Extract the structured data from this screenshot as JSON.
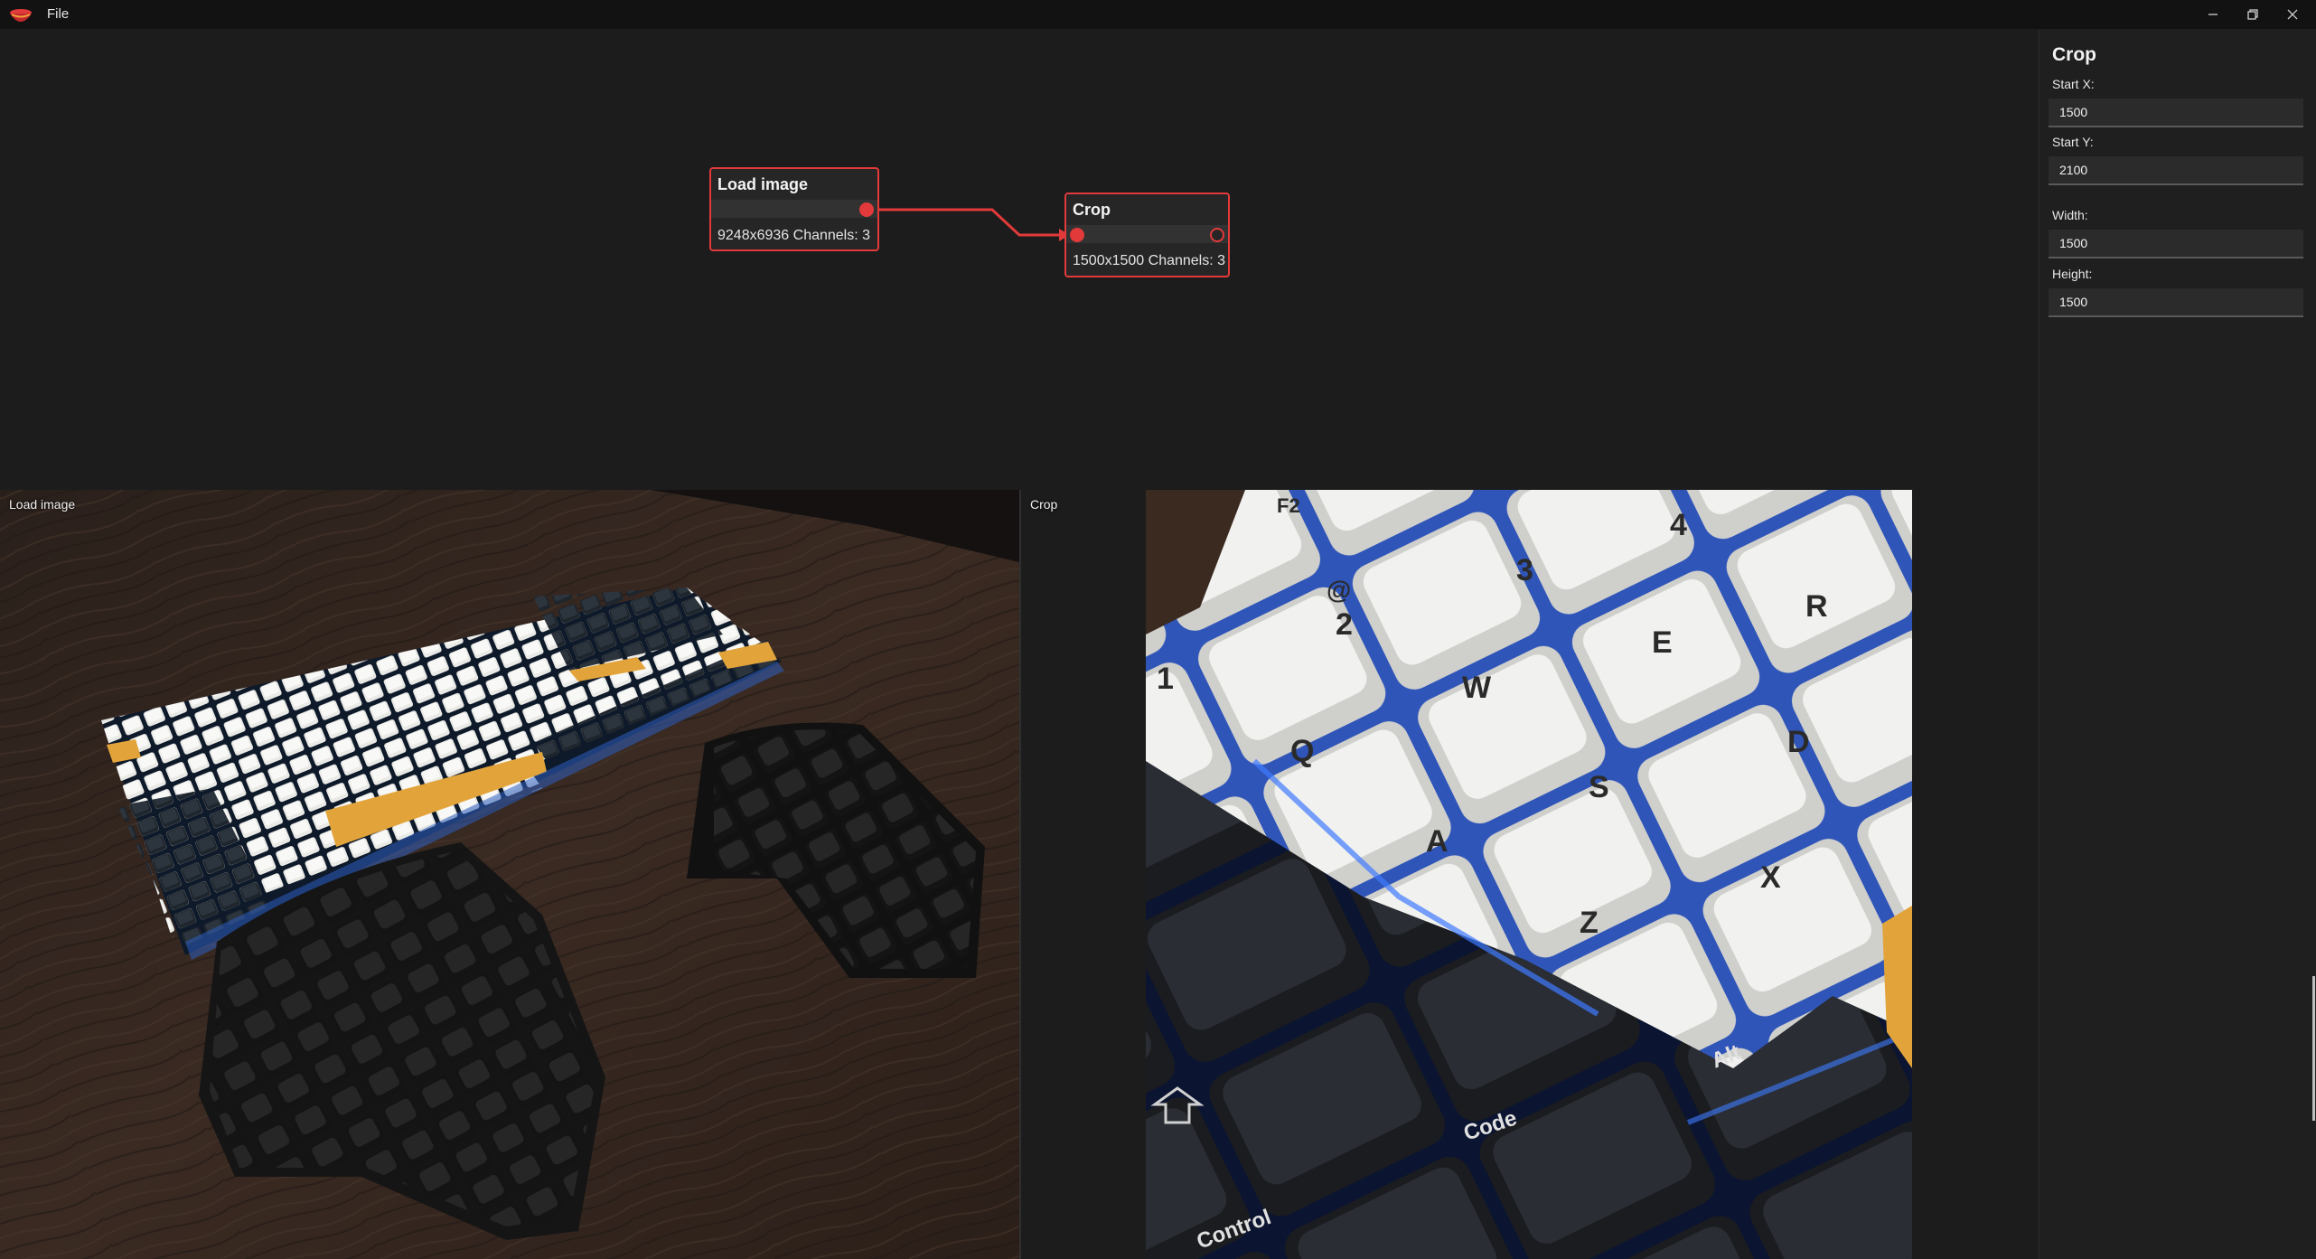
{
  "titlebar": {
    "menu": [
      {
        "label": "File"
      }
    ],
    "icons": {
      "logo": "bowl-logo-icon",
      "minimize": "minimize-icon",
      "restore": "restore-icon",
      "close": "close-icon"
    }
  },
  "graph": {
    "nodes": [
      {
        "title": "Load image",
        "info": "9248x6936 Channels: 3"
      },
      {
        "title": "Crop",
        "info": "1500x1500 Channels: 3"
      }
    ],
    "accent_color": "#e23a3a"
  },
  "properties": {
    "title": "Crop",
    "fields": [
      {
        "label": "Start X:",
        "value": "1500"
      },
      {
        "label": "Start Y:",
        "value": "2100"
      },
      {
        "label": "Width:",
        "value": "1500"
      },
      {
        "label": "Height:",
        "value": "1500"
      }
    ]
  },
  "previews": [
    {
      "label": "Load image",
      "content": "photo of keyboards on wooden desk"
    },
    {
      "label": "Crop",
      "content": "close-up of white and black keycaps"
    }
  ]
}
